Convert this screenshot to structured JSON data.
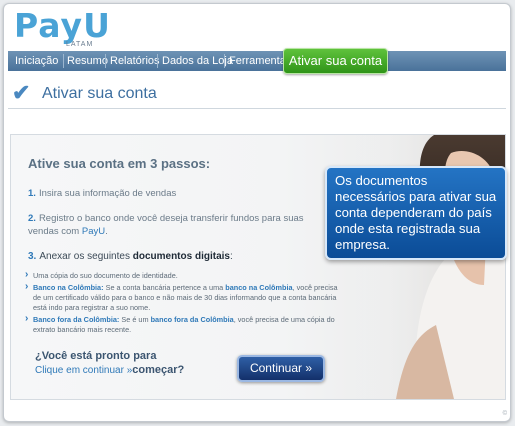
{
  "brand": {
    "logo_text": "PayU",
    "logo_sub": "LATAM"
  },
  "nav": {
    "items": [
      {
        "label": "Iniciação"
      },
      {
        "label": "Resumo"
      },
      {
        "label": "Relatórios"
      },
      {
        "label": "Dados da Loja"
      },
      {
        "label": "Ferramentas"
      }
    ],
    "active_label": "Ativar sua conta"
  },
  "page": {
    "title": "Ativar sua conta"
  },
  "steps": {
    "title": "Ative sua conta em 3 passos:",
    "step1": {
      "num": "1.",
      "text": "Insira sua informação de vendas"
    },
    "step2": {
      "num": "2.",
      "text": "Registro o banco onde você deseja transferir fundos para suas vendas com ",
      "link": "PayU",
      "after": "."
    },
    "step3": {
      "num": "3.",
      "text": "Anexar os seguintes ",
      "strong": "documentos digitais",
      "after": ":"
    }
  },
  "bullets": [
    {
      "text": "Uma cópia do suo documento de identidade."
    },
    {
      "hl": "Banco na Colômbia:",
      "text": " Se a conta bancária pertence a uma ",
      "hl2": "banco na Colômbia",
      "text2": ", você precisa de um certificado válido para o banco e não mais de 30 dias informando que a conta bancária está indo para registrar a suo nome."
    },
    {
      "hl": "Banco fora da Colômbia:",
      "text": " Se é um ",
      "hl2": "banco fora da Colômbia",
      "text2": ", você precisa de uma cópia do extrato bancário mais recente."
    }
  ],
  "ready": {
    "question": "¿Você está pronto para",
    "sub_prefix": "Clique em continuar »",
    "sub_strong": "começar?"
  },
  "continue_button": "Continuar »",
  "tooltip": {
    "text": "Os documentos necessários para ativar sua conta dependeram do país onde esta registrada sua empresa."
  },
  "footer": {
    "copyright": "©"
  },
  "colors": {
    "brand_blue": "#4aa3d6",
    "nav_bg": "#5a82a9",
    "active_tab": "#3fa61f",
    "tooltip_bg": "#1464b4",
    "button_bg": "#1c3f80"
  }
}
